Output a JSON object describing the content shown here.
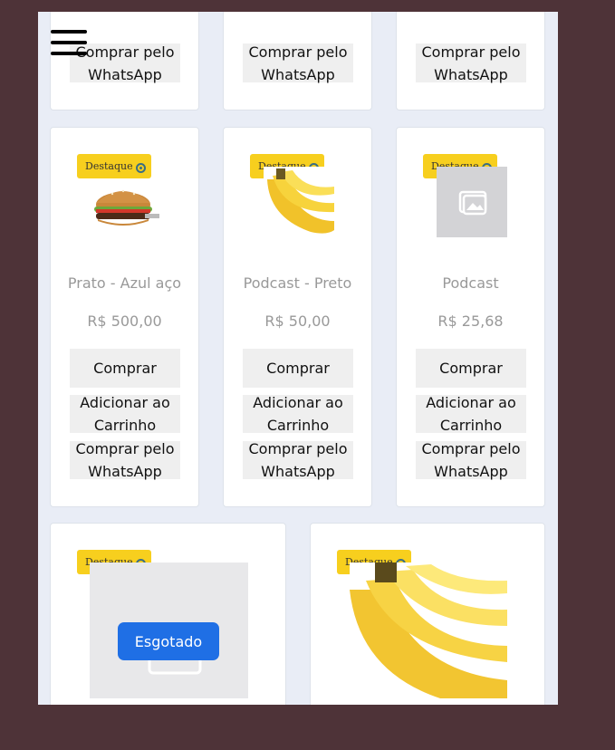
{
  "menu": {
    "icon": "hamburger-menu-icon"
  },
  "top_row": [
    {
      "whatsapp_label": "Comprar pelo WhatsApp"
    },
    {
      "whatsapp_label": "Comprar pelo WhatsApp"
    },
    {
      "whatsapp_label": "Comprar pelo WhatsApp"
    }
  ],
  "products": [
    {
      "badge": "Destaque",
      "name": "Prato - Azul aço",
      "price": "R$ 500,00",
      "buy_label": "Comprar",
      "cart_label": "Adicionar ao Carrinho",
      "whatsapp_label": "Comprar pelo WhatsApp",
      "image": "burger-image"
    },
    {
      "badge": "Destaque",
      "name": "Podcast - Preto",
      "price": "R$ 50,00",
      "buy_label": "Comprar",
      "cart_label": "Adicionar ao Carrinho",
      "whatsapp_label": "Comprar pelo WhatsApp",
      "image": "banana-image"
    },
    {
      "badge": "Destaque",
      "name": "Podcast",
      "price": "R$ 25,68",
      "buy_label": "Comprar",
      "cart_label": "Adicionar ao Carrinho",
      "whatsapp_label": "Comprar pelo WhatsApp",
      "image": "image-placeholder-icon"
    }
  ],
  "bottom_row": [
    {
      "badge": "Destaque",
      "status": "Esgotado",
      "image": "image-placeholder-icon"
    },
    {
      "badge": "Destaque",
      "image": "banana-image"
    }
  ],
  "colors": {
    "badge": "#f7cf1e",
    "esgotado": "#1f6fe5",
    "background": "#4e3338"
  }
}
